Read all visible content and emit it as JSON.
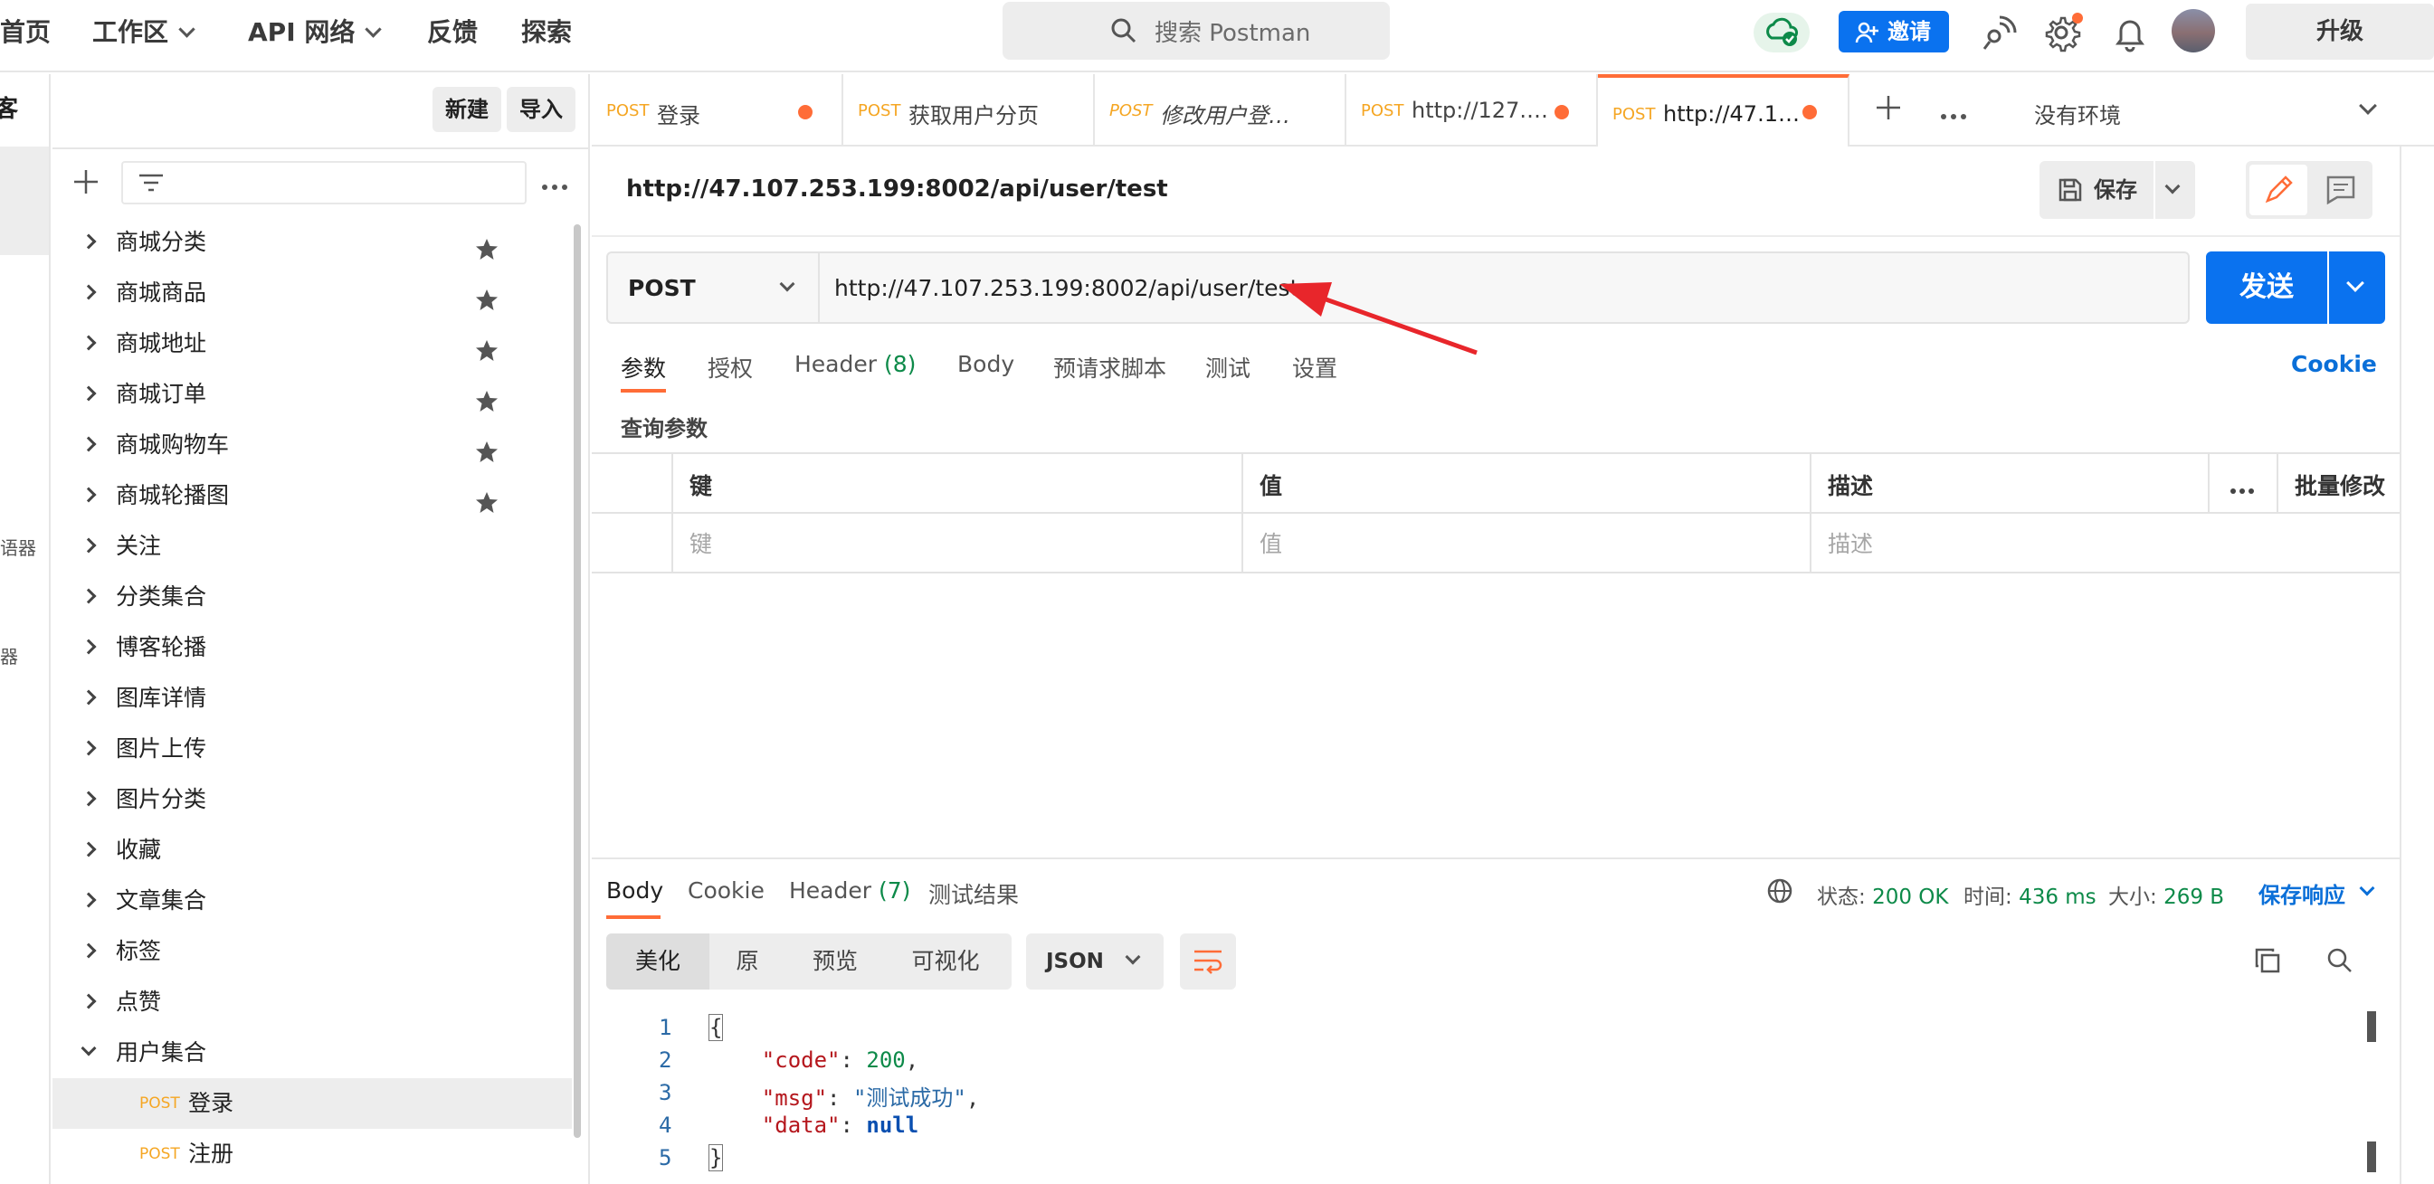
{
  "nav": {
    "home": "首页",
    "workspaces": "工作区",
    "api_network": "API 网络",
    "feedback": "反馈",
    "explore": "探索"
  },
  "search": {
    "placeholder": "搜索 Postman"
  },
  "header": {
    "invite": "邀请",
    "upgrade": "升级"
  },
  "rail": {
    "item1": "语器",
    "item2": "器"
  },
  "sidebar": {
    "workspace_title": "柚博客",
    "new": "新建",
    "import": "导入",
    "collections": [
      {
        "label": "商城分类",
        "starred": true
      },
      {
        "label": "商城商品",
        "starred": true
      },
      {
        "label": "商城地址",
        "starred": true
      },
      {
        "label": "商城订单",
        "starred": true
      },
      {
        "label": "商城购物车",
        "starred": true
      },
      {
        "label": "商城轮播图",
        "starred": true
      },
      {
        "label": "关注"
      },
      {
        "label": "分类集合"
      },
      {
        "label": "博客轮播"
      },
      {
        "label": "图库详情"
      },
      {
        "label": "图片上传"
      },
      {
        "label": "图片分类"
      },
      {
        "label": "收藏"
      },
      {
        "label": "文章集合"
      },
      {
        "label": "标签"
      },
      {
        "label": "点赞"
      },
      {
        "label": "用户集合",
        "open": true
      }
    ],
    "requests": [
      {
        "method": "POST",
        "label": "登录",
        "selected": true
      },
      {
        "method": "POST",
        "label": "注册"
      }
    ]
  },
  "tabs": [
    {
      "method": "POST",
      "title": "登录",
      "dirty": true
    },
    {
      "method": "POST",
      "title": "获取用户分页"
    },
    {
      "method": "POST",
      "title": "修改用户登…",
      "italic": true
    },
    {
      "method": "POST",
      "title": "http://127.…",
      "dirty": true
    },
    {
      "method": "POST",
      "title": "http://47.1…",
      "dirty": true,
      "active": true
    }
  ],
  "environment": "没有环境",
  "request": {
    "title": "http://47.107.253.199:8002/api/user/test",
    "save": "保存",
    "method": "POST",
    "url": "http://47.107.253.199:8002/api/user/test",
    "send": "发送",
    "tabs": {
      "params": "参数",
      "auth": "授权",
      "header": "Header",
      "header_count": "(8)",
      "body": "Body",
      "prerequest": "预请求脚本",
      "tests": "测试",
      "settings": "设置"
    },
    "cookie": "Cookie",
    "query_label": "查询参数",
    "table": {
      "key": "键",
      "value": "值",
      "description": "描述",
      "bulk_edit": "批量修改",
      "key_placeholder": "键",
      "value_placeholder": "值",
      "description_placeholder": "描述"
    }
  },
  "response": {
    "tabs": {
      "body": "Body",
      "cookie": "Cookie",
      "header": "Header",
      "header_count": "(7)",
      "test_results": "测试结果"
    },
    "status_label": "状态:",
    "status_value": "200 OK",
    "time_label": "时间:",
    "time_value": "436 ms",
    "size_label": "大小:",
    "size_value": "269 B",
    "save_response": "保存响应",
    "views": {
      "pretty": "美化",
      "raw": "原",
      "preview": "预览",
      "visualize": "可视化"
    },
    "format": "JSON",
    "lines": [
      "1",
      "2",
      "3",
      "4",
      "5"
    ],
    "json": {
      "open": "{",
      "code_key": "\"code\"",
      "code_val": "200",
      "msg_key": "\"msg\"",
      "msg_val": "\"测试成功\"",
      "data_key": "\"data\"",
      "data_val": "null",
      "close": "}"
    }
  },
  "colors": {
    "accent": "#ff6c37",
    "primary": "#0a72ef",
    "success": "#0d8a49",
    "method_post": "#f5a623",
    "annotation_arrow": "#e8262b"
  }
}
